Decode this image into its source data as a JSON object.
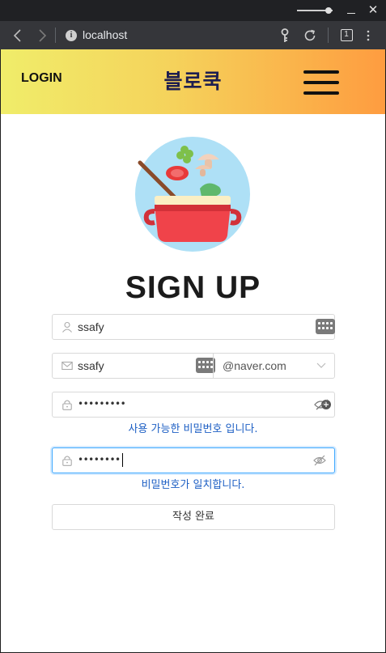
{
  "browser": {
    "address": "localhost",
    "tab_count": "1"
  },
  "nav": {
    "login_label": "LOGIN",
    "brand": "블로쿡"
  },
  "page": {
    "title": "SIGN UP"
  },
  "form": {
    "username_value": "ssafy",
    "email_local_value": "ssafy",
    "email_domain_value": "@naver.com",
    "password_masked": "•••••••••",
    "password_hint": "사용 가능한 비밀번호 입니다.",
    "confirm_masked": "••••••••",
    "confirm_hint": "비밀번호가 일치합니다.",
    "submit_label": "작성 완료"
  },
  "colors": {
    "nav_gradient_start": "#f0ed6a",
    "nav_gradient_end": "#fe9c40",
    "hint_text": "#1d5fc4",
    "focus_border": "#40a9ff"
  },
  "icons": {
    "back": "arrow-left-icon",
    "forward": "arrow-right-icon",
    "info": "info-icon",
    "key": "key-icon",
    "reload": "reload-icon",
    "menu": "kebab-menu-icon",
    "hamburger": "hamburger-menu-icon",
    "user": "user-icon",
    "mail": "mail-icon",
    "lock": "lock-icon",
    "eye": "eye-invisible-icon",
    "chevron": "chevron-down-icon",
    "logo": "cooking-pot-logo"
  }
}
